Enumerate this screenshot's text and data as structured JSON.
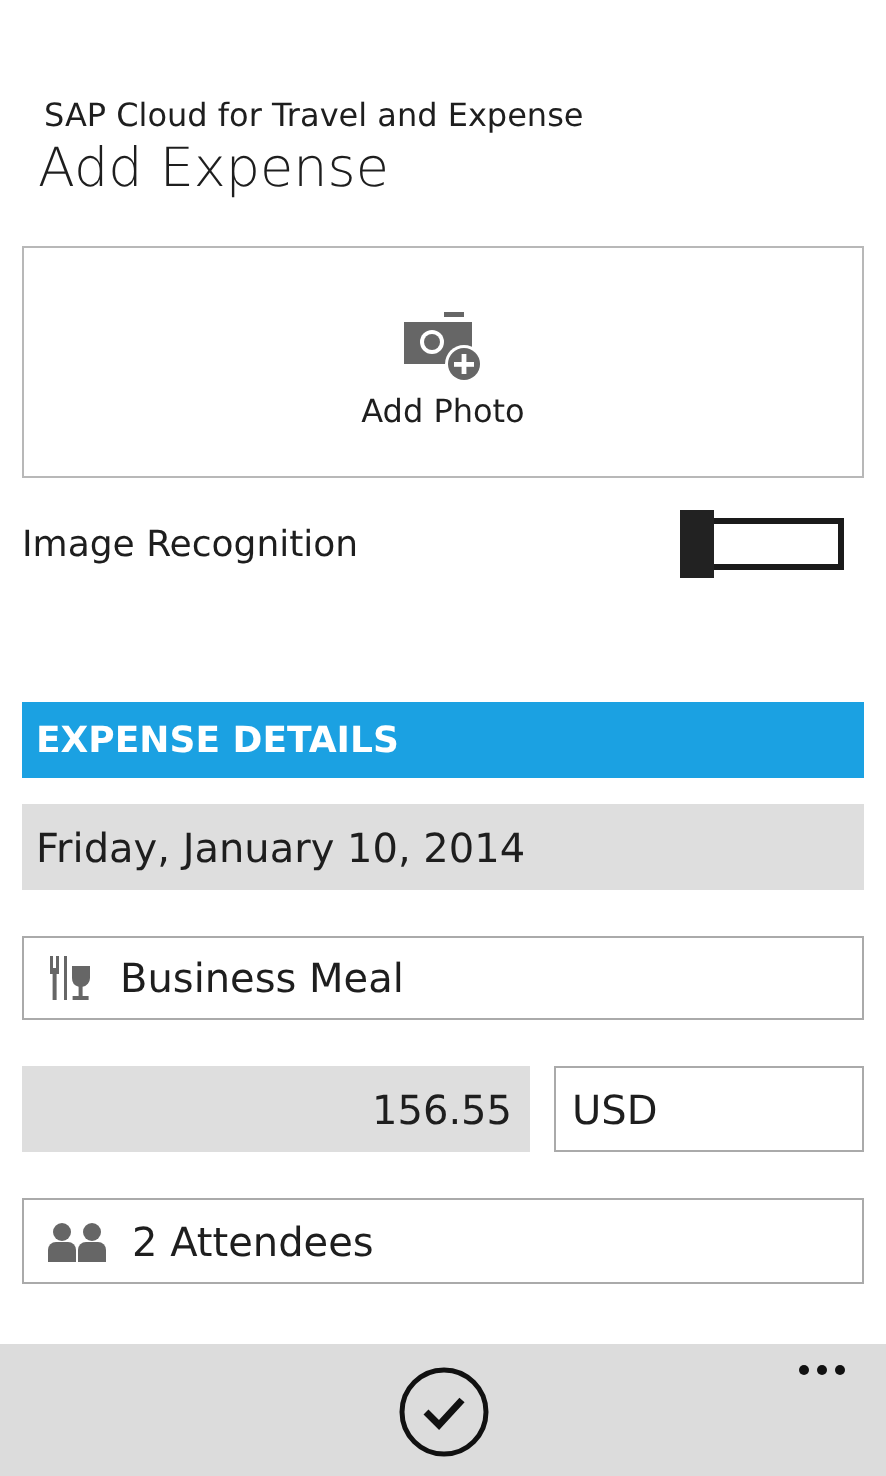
{
  "app_name": "SAP Cloud for Travel and Expense",
  "page_title": "Add Expense",
  "add_photo": {
    "label": "Add Photo"
  },
  "image_recognition": {
    "label": "Image Recognition",
    "on": false
  },
  "section_header": "EXPENSE DETAILS",
  "fields": [
    {
      "kind": "date",
      "value": "Friday, January 10, 2014"
    },
    {
      "kind": "category",
      "value": "Business Meal"
    },
    {
      "kind": "amount",
      "value": "156.55",
      "currency": "USD"
    },
    {
      "kind": "attendees",
      "value": "2 Attendees"
    }
  ]
}
